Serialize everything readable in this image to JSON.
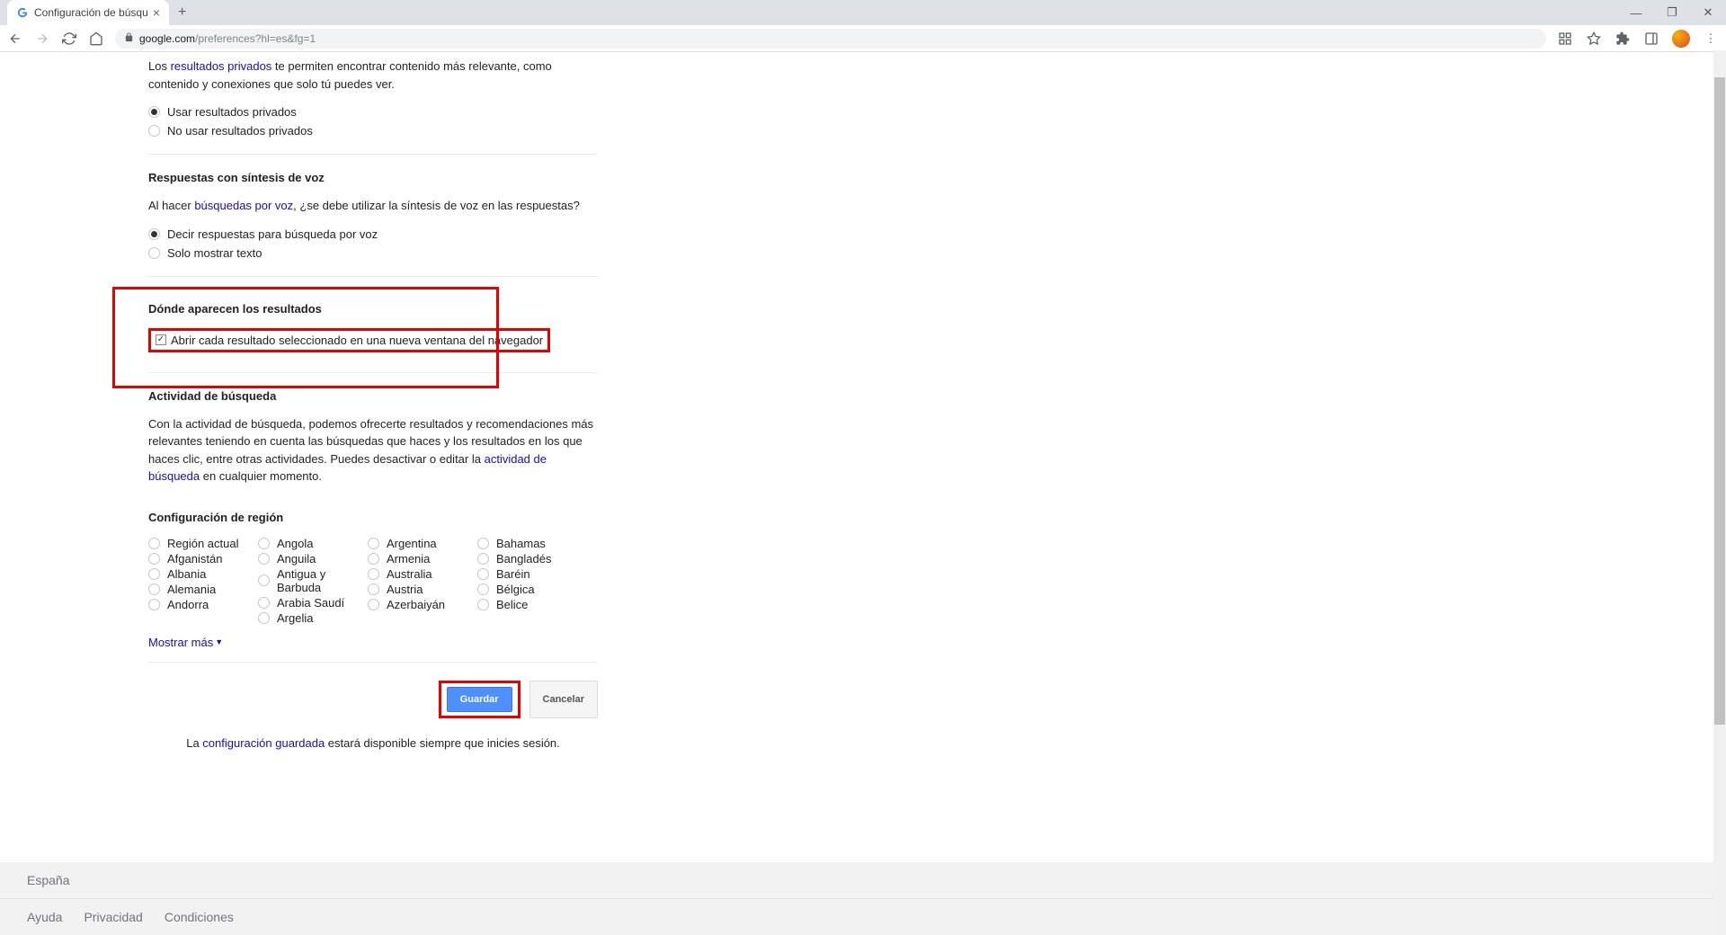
{
  "browser": {
    "tab_title": "Configuración de búsqueda",
    "url_domain": "google.com",
    "url_path": "/preferences?hl=es&fg=1"
  },
  "private_results": {
    "desc_prefix": "Los ",
    "link": "resultados privados",
    "desc_suffix": " te permiten encontrar contenido más relevante, como contenido y conexiones que solo tú puedes ver.",
    "opt_use": "Usar resultados privados",
    "opt_no_use": "No usar resultados privados"
  },
  "voice": {
    "title": "Respuestas con síntesis de voz",
    "desc_prefix": "Al hacer ",
    "link": "búsquedas por voz",
    "desc_suffix": ", ¿se debe utilizar la síntesis de voz en las respuestas?",
    "opt_speak": "Decir respuestas para búsqueda por voz",
    "opt_text": "Solo mostrar texto"
  },
  "results_where": {
    "title": "Dónde aparecen los resultados",
    "checkbox_label": "Abrir cada resultado seleccionado en una nueva ventana del navegador"
  },
  "activity": {
    "title": "Actividad de búsqueda",
    "desc_prefix": "Con la actividad de búsqueda, podemos ofrecerte resultados y recomendaciones más relevantes teniendo en cuenta las búsquedas que haces y los resultados en los que haces clic, entre otras actividades. Puedes desactivar o editar la ",
    "link": "actividad de búsqueda",
    "desc_suffix": " en cualquier momento."
  },
  "region": {
    "title": "Configuración de región",
    "cols": [
      [
        "Región actual",
        "Afganistán",
        "Albania",
        "Alemania",
        "Andorra"
      ],
      [
        "Angola",
        "Anguila",
        "Antigua y Barbuda",
        "Arabia Saudí",
        "Argelia"
      ],
      [
        "Argentina",
        "Armenia",
        "Australia",
        "Austria",
        "Azerbaiyán"
      ],
      [
        "Bahamas",
        "Bangladés",
        "Baréin",
        "Bélgica",
        "Belice"
      ]
    ],
    "show_more": "Mostrar más"
  },
  "buttons": {
    "save": "Guardar",
    "cancel": "Cancelar"
  },
  "footer_note": {
    "prefix": "La ",
    "link": "configuración guardada",
    "suffix": " estará disponible siempre que inicies sesión."
  },
  "page_footer": {
    "country": "España",
    "links": [
      "Ayuda",
      "Privacidad",
      "Condiciones"
    ]
  }
}
